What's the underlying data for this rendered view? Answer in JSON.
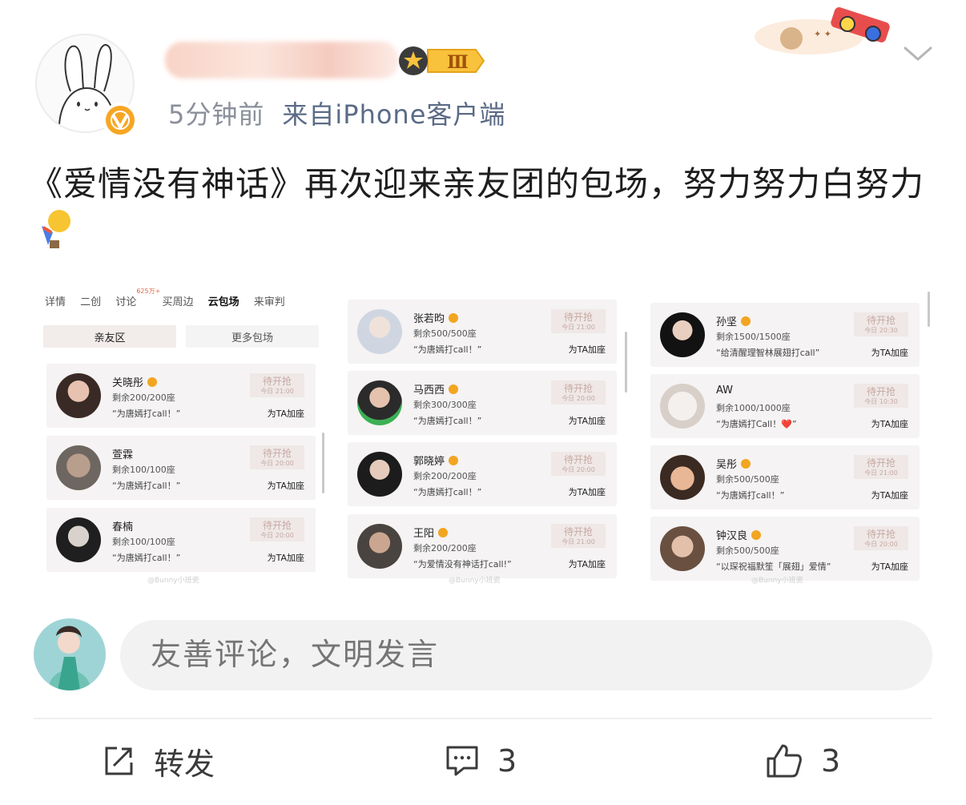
{
  "post": {
    "meta_time": "5分钟前",
    "meta_source": "来自iPhone客户端",
    "text": "《爱情没有神话》再次迎来亲友团的包场，努力努力白努力",
    "level_badge": "Ⅲ"
  },
  "collage": {
    "tabs": [
      "详情",
      "二创",
      "讨论",
      "买周边",
      "云包场",
      "来审判"
    ],
    "tab_tag": "625万+",
    "active_tab": "云包场",
    "buttons": [
      "亲友区",
      "更多包场"
    ],
    "wait_label": "待开抢",
    "boost_label": "为TA加座",
    "watermark": "@Bunny小班瓷",
    "panels": [
      [
        {
          "name": "关晓彤",
          "seats": "剩余200/200座",
          "quote": "“为唐嫣打call！”",
          "time": "今日 21:00"
        },
        {
          "name": "萱霖",
          "seats": "剩余100/100座",
          "quote": "“为唐嫣打call！”",
          "time": "今日 20:00"
        },
        {
          "name": "春楠",
          "seats": "剩余100/100座",
          "quote": "“为唐嫣打call！”",
          "time": "今日 20:00"
        }
      ],
      [
        {
          "name": "张若昀",
          "seats": "剩余500/500座",
          "quote": "“为唐嫣打call！”",
          "time": "今日 21:00"
        },
        {
          "name": "马西西",
          "seats": "剩余300/300座",
          "quote": "“为唐嫣打call！”",
          "time": "今日 20:00"
        },
        {
          "name": "郭晓婷",
          "seats": "剩余200/200座",
          "quote": "“为唐嫣打call！”",
          "time": "今日 20:00"
        },
        {
          "name": "王阳",
          "seats": "剩余200/200座",
          "quote": "“为爱情没有神话打call!”",
          "time": "今日 21:00"
        }
      ],
      [
        {
          "name": "孙坚",
          "seats": "剩余1500/1500座",
          "quote": "“给清醒理智林展翅打call”",
          "time": "今日 20:30"
        },
        {
          "name": "AW",
          "seats": "剩余1000/1000座",
          "quote": "“为唐嫣打Call！❤️”",
          "time": "今日 10:30"
        },
        {
          "name": "吴彤",
          "seats": "剩余500/500座",
          "quote": "“为唐嫣打call！”",
          "time": "今日 21:00"
        },
        {
          "name": "钟汉良",
          "seats": "剩余500/500座",
          "quote": "“以琛祝福默笙「展翅」爱情”",
          "time": "今日 20:00"
        }
      ]
    ]
  },
  "comment": {
    "placeholder": "友善评论，文明发言"
  },
  "actions": {
    "repost_label": "转发",
    "comment_count": "3",
    "like_count": "3"
  },
  "colors": {
    "accent_orange": "#f6a623",
    "meta_grey": "#8a8f99",
    "source_blue": "#5b6b86"
  }
}
